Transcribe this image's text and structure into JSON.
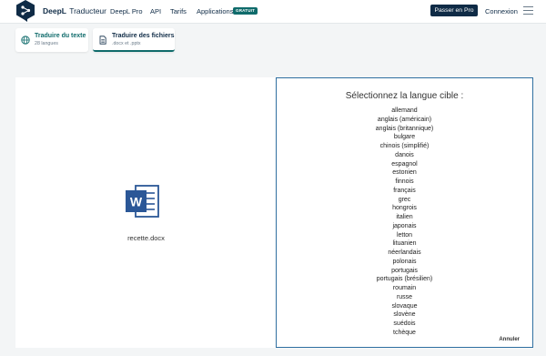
{
  "header": {
    "brand": "DeepL",
    "product": "Traducteur",
    "nav": [
      "DeepL Pro",
      "API",
      "Tarifs",
      "Applications"
    ],
    "badge": "GRATUIT",
    "cta": "Passer en Pro",
    "login": "Connexion"
  },
  "tabs": [
    {
      "label": "Traduire du texte",
      "sub": "28 langues"
    },
    {
      "label": "Traduire des fichiers",
      "sub": ".docx et .pptx"
    }
  ],
  "file": {
    "name": "recette.docx",
    "icon": "word-file-icon"
  },
  "target_picker": {
    "title": "Sélectionnez la langue cible :",
    "languages": [
      "allemand",
      "anglais (américain)",
      "anglais (britannique)",
      "bulgare",
      "chinois (simplifié)",
      "danois",
      "espagnol",
      "estonien",
      "finnois",
      "français",
      "grec",
      "hongrois",
      "italien",
      "japonais",
      "letton",
      "lituanien",
      "néerlandais",
      "polonais",
      "portugais",
      "portugais (brésilien)",
      "roumain",
      "russe",
      "slovaque",
      "slovène",
      "suédois",
      "tchèque"
    ],
    "cancel": "Annuler"
  },
  "colors": {
    "brand": "#0f2b46",
    "accent": "#0f6b6b",
    "word": "#2b5797",
    "panel_border": "#2f6fa0"
  }
}
